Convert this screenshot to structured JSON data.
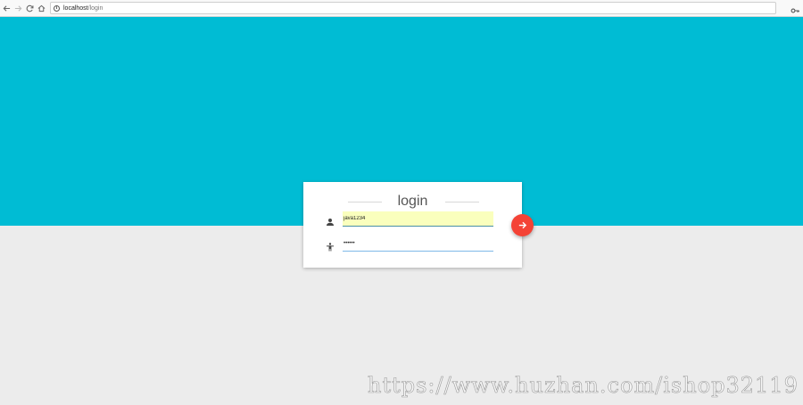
{
  "browser": {
    "url_host": "localhost",
    "url_path": "/login",
    "info_glyph": "i",
    "icons": {
      "back": "back-arrow-icon",
      "forward": "forward-arrow-icon",
      "reload": "reload-icon",
      "home": "home-icon",
      "info": "info-icon",
      "key": "key-icon"
    }
  },
  "login": {
    "title": "login",
    "username": {
      "value": "java1234",
      "icon": "person-icon"
    },
    "password": {
      "value": "••••••",
      "icon": "accessibility-icon"
    },
    "submit_icon": "arrow-forward-icon"
  },
  "watermark": "https://www.huzhan.com/ishop32119",
  "colors": {
    "hero_background": "#00bcd4",
    "page_background": "#ececec",
    "submit_button": "#f44336",
    "autofill_background": "#faffbd"
  }
}
